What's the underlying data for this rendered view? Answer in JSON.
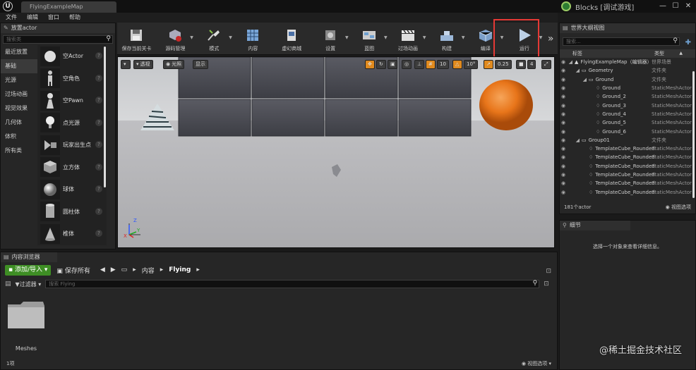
{
  "titlebar": {
    "logo": "U",
    "doc_tab": "FlyingExampleMap",
    "project": "Blocks [调试游戏]",
    "minimize": "—",
    "maximize": "☐",
    "close": "✕"
  },
  "menubar": [
    "文件",
    "编辑",
    "窗口",
    "帮助"
  ],
  "place_actors": {
    "tab": "放置actor",
    "search_placeholder": "搜索类",
    "categories": [
      "最近放置",
      "基础",
      "光源",
      "过场动画",
      "视觉效果",
      "几何体",
      "体积",
      "所有类"
    ],
    "selected_category": "基础",
    "items": [
      "空Actor",
      "空角色",
      "空Pawn",
      "点光源",
      "玩家出生点",
      "立方体",
      "球体",
      "圆柱体",
      "椎体"
    ]
  },
  "toolbar": {
    "buttons": [
      {
        "label": "保存当前关卡",
        "icon": "save-icon"
      },
      {
        "label": "源码管理",
        "icon": "source-control-icon"
      },
      {
        "label": "模式",
        "icon": "modes-icon"
      },
      {
        "label": "内容",
        "icon": "content-icon"
      },
      {
        "label": "虚幻商城",
        "icon": "marketplace-icon"
      },
      {
        "label": "设置",
        "icon": "settings-icon"
      },
      {
        "label": "蓝图",
        "icon": "blueprint-icon"
      },
      {
        "label": "过场动画",
        "icon": "cinematics-icon"
      },
      {
        "label": "构建",
        "icon": "build-icon"
      },
      {
        "label": "编译",
        "icon": "compile-icon"
      },
      {
        "label": "运行",
        "icon": "play-icon"
      }
    ],
    "more": "»"
  },
  "viewport": {
    "perspective": "透视",
    "lit": "光照",
    "show": "显示",
    "grid_snap": "10",
    "rotate_snap": "10°",
    "scale_snap": "0.25",
    "camera_speed": "4",
    "axis_z": "Z",
    "axis_y": "Y",
    "axis_x": "X"
  },
  "outliner": {
    "tab": "世界大纲视图",
    "search_placeholder": "搜索...",
    "col_label": "标签",
    "col_type": "类型",
    "rows": [
      {
        "name": "FlyingExampleMap（编辑器）",
        "type": "世界场景",
        "indent": 0
      },
      {
        "name": "Geometry",
        "type": "文件夹",
        "indent": 1
      },
      {
        "name": "Ground",
        "type": "文件夹",
        "indent": 2
      },
      {
        "name": "Ground",
        "type": "StaticMeshActor",
        "indent": 3
      },
      {
        "name": "Ground_2",
        "type": "StaticMeshActor",
        "indent": 3
      },
      {
        "name": "Ground_3",
        "type": "StaticMeshActor",
        "indent": 3
      },
      {
        "name": "Ground_4",
        "type": "StaticMeshActor",
        "indent": 3
      },
      {
        "name": "Ground_5",
        "type": "StaticMeshActor",
        "indent": 3
      },
      {
        "name": "Ground_6",
        "type": "StaticMeshActor",
        "indent": 3
      },
      {
        "name": "Group01",
        "type": "文件夹",
        "indent": 1
      },
      {
        "name": "TemplateCube_Rounded",
        "type": "StaticMeshActor",
        "indent": 2
      },
      {
        "name": "TemplateCube_Rounded",
        "type": "StaticMeshActor",
        "indent": 2
      },
      {
        "name": "TemplateCube_Rounded",
        "type": "StaticMeshActor",
        "indent": 2
      },
      {
        "name": "TemplateCube_Rounded",
        "type": "StaticMeshActor",
        "indent": 2
      },
      {
        "name": "TemplateCube_Rounded",
        "type": "StaticMeshActor",
        "indent": 2
      },
      {
        "name": "TemplateCube_Rounded",
        "type": "StaticMeshActor",
        "indent": 2
      }
    ],
    "count": "181个actor",
    "view_options": "视图选项"
  },
  "details": {
    "tab": "细节",
    "empty_text": "选择一个对象来查看详细信息。"
  },
  "content_browser": {
    "tab": "内容浏览器",
    "add_import": "添加/导入",
    "save_all": "保存所有",
    "path": [
      "内容",
      "Flying"
    ],
    "filters": "过滤器",
    "search_placeholder": "搜索 Flying",
    "folder_name": "Meshes",
    "item_count": "1项",
    "view_options": "视图选项"
  },
  "watermark": "@稀土掘金技术社区",
  "colors": {
    "accent_green": "#3e8e24",
    "highlight_red": "#e53935",
    "sphere_orange": "#e8751a"
  }
}
